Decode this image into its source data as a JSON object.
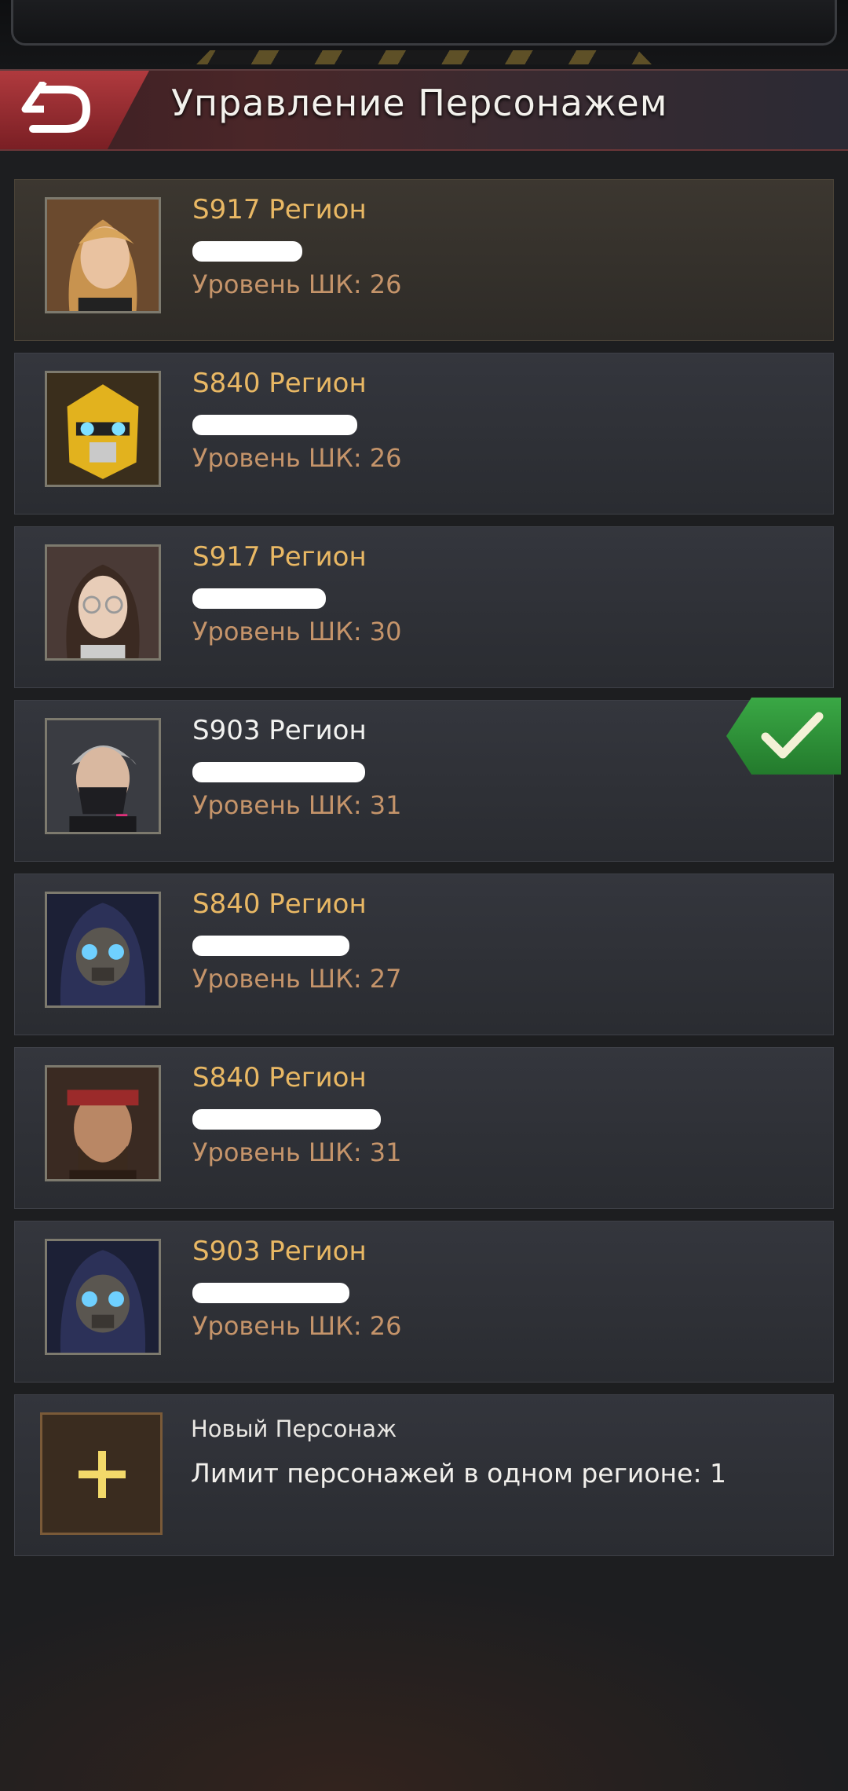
{
  "header": {
    "title": "Управление Персонажем",
    "back_icon": "back-arrow-icon"
  },
  "characters": [
    {
      "region": "S917 Регион",
      "level": "Уровень ШК: 26",
      "avatar": "woman-blonde",
      "selected": false
    },
    {
      "region": "S840 Регион",
      "level": "Уровень ШК: 26",
      "avatar": "yellow-robot",
      "selected": false
    },
    {
      "region": "S917 Регион",
      "level": "Уровень ШК: 30",
      "avatar": "woman-glasses",
      "selected": false
    },
    {
      "region": "S903 Регион",
      "level": "Уровень ШК: 31",
      "avatar": "masked-man",
      "selected": true
    },
    {
      "region": "S840 Регион",
      "level": "Уровень ШК: 27",
      "avatar": "hooded-robot",
      "selected": false
    },
    {
      "region": "S840 Регион",
      "level": "Уровень ШК: 31",
      "avatar": "pirate-man",
      "selected": false
    },
    {
      "region": "S903 Регион",
      "level": "Уровень ШК: 26",
      "avatar": "hooded-robot",
      "selected": false
    }
  ],
  "new_character": {
    "title": "Новый Персонаж",
    "limit": "Лимит персонажей в одном регионе: 1",
    "icon": "plus-icon"
  },
  "colors": {
    "region_text": "#e9b864",
    "level_text": "#c5946a",
    "selected_check": "#3aa845"
  }
}
